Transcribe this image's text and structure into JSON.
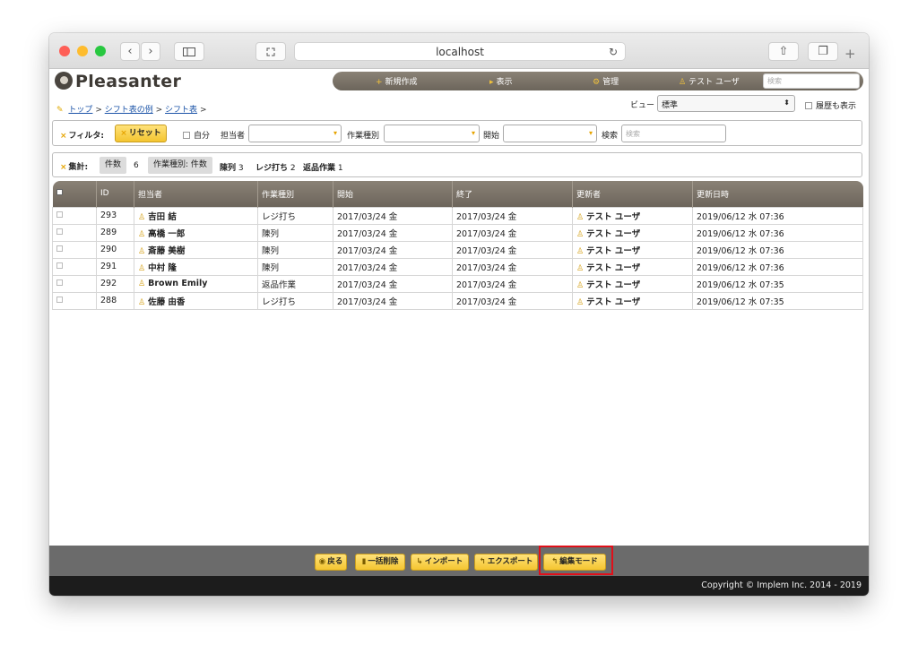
{
  "browser": {
    "url": "localhost"
  },
  "app": {
    "logo": "Pleasanter"
  },
  "nav": {
    "new": "新規作成",
    "view": "表示",
    "admin": "管理",
    "user": "テスト ユーザ",
    "search_placeholder": "検索"
  },
  "breadcrumb": {
    "top": "トップ",
    "sep": ">",
    "example": "シフト表の例",
    "current": "シフト表",
    "trail": ">"
  },
  "view": {
    "label": "ビュー",
    "selected": "標準",
    "show_history": "履歴も表示"
  },
  "filter": {
    "label": "フィルタ:",
    "reset": "リセット",
    "self": "自分",
    "assignee": "担当者",
    "work_type": "作業種別",
    "start": "開始",
    "search": "検索",
    "search_placeholder": "検索"
  },
  "aggregate": {
    "label": "集計:",
    "count_label": "件数",
    "count_value": "6",
    "group_label": "作業種別: 件数",
    "g1_name": "陳列",
    "g1_value": "3",
    "g2_name": "レジ打ち",
    "g2_value": "2",
    "g3_name": "返品作業",
    "g3_value": "1"
  },
  "table": {
    "headers": [
      "ID",
      "担当者",
      "作業種別",
      "開始",
      "終了",
      "更新者",
      "更新日時"
    ],
    "rows": [
      {
        "id": "293",
        "assignee": "吉田 結",
        "work_type": "レジ打ち",
        "start": "2017/03/24 金",
        "end": "2017/03/24 金",
        "updater": "テスト ユーザ",
        "updated": "2019/06/12 水 07:36"
      },
      {
        "id": "289",
        "assignee": "高橋 一郎",
        "work_type": "陳列",
        "start": "2017/03/24 金",
        "end": "2017/03/24 金",
        "updater": "テスト ユーザ",
        "updated": "2019/06/12 水 07:36"
      },
      {
        "id": "290",
        "assignee": "斎藤 美樹",
        "work_type": "陳列",
        "start": "2017/03/24 金",
        "end": "2017/03/24 金",
        "updater": "テスト ユーザ",
        "updated": "2019/06/12 水 07:36"
      },
      {
        "id": "291",
        "assignee": "中村 隆",
        "work_type": "陳列",
        "start": "2017/03/24 金",
        "end": "2017/03/24 金",
        "updater": "テスト ユーザ",
        "updated": "2019/06/12 水 07:36"
      },
      {
        "id": "292",
        "assignee": "Brown Emily",
        "work_type": "返品作業",
        "start": "2017/03/24 金",
        "end": "2017/03/24 金",
        "updater": "テスト ユーザ",
        "updated": "2019/06/12 水 07:35"
      },
      {
        "id": "288",
        "assignee": "佐藤 由香",
        "work_type": "レジ打ち",
        "start": "2017/03/24 金",
        "end": "2017/03/24 金",
        "updater": "テスト ユーザ",
        "updated": "2019/06/12 水 07:35"
      }
    ]
  },
  "footer": {
    "back": "戻る",
    "bulk_delete": "一括削除",
    "import": "インポート",
    "export": "エクスポート",
    "edit_mode": "編集モード",
    "copyright": "Copyright © Implem Inc. 2014 - 2019"
  },
  "colors": {
    "accent": "#f4c530",
    "header_bg": "#6c655b",
    "highlight": "#e0101a"
  }
}
